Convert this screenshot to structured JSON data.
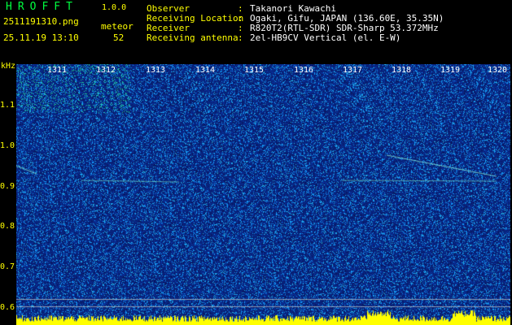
{
  "app": {
    "title": "HROFFT",
    "version": "1.0.0"
  },
  "file": {
    "name": "2511191310.png",
    "datetime": "25.11.19 13:10",
    "mode": "meteor",
    "count": "52"
  },
  "info": [
    {
      "key": "Observer",
      "sep": ":",
      "value": "Takanori Kawachi"
    },
    {
      "key": "Receiving Location",
      "sep": ":",
      "value": "Ogaki, Gifu, JAPAN (136.60E, 35.35N)"
    },
    {
      "key": "Receiver",
      "sep": ":",
      "value": "R820T2(RTL-SDR) SDR-Sharp 53.372MHz"
    },
    {
      "key": "Receiving antenna",
      "sep": ":",
      "value": "2el-HB9CV Vertical (el. E-W)"
    }
  ],
  "spectrogram": {
    "y_unit": "kHz",
    "y_ticks": [
      "1.1",
      "1.0",
      "0.9",
      "0.8",
      "0.7",
      "0.6"
    ],
    "x_ticks": [
      "1311",
      "1312",
      "1313",
      "1314",
      "1315",
      "1316",
      "1317",
      "1318",
      "1319",
      "1320"
    ],
    "colors": {
      "background": "#0a1a6e",
      "noise_hi": "#1a5acc",
      "echo": "#00ff80",
      "baseline": "#ffff00",
      "text_axis": "#ffff00"
    }
  }
}
